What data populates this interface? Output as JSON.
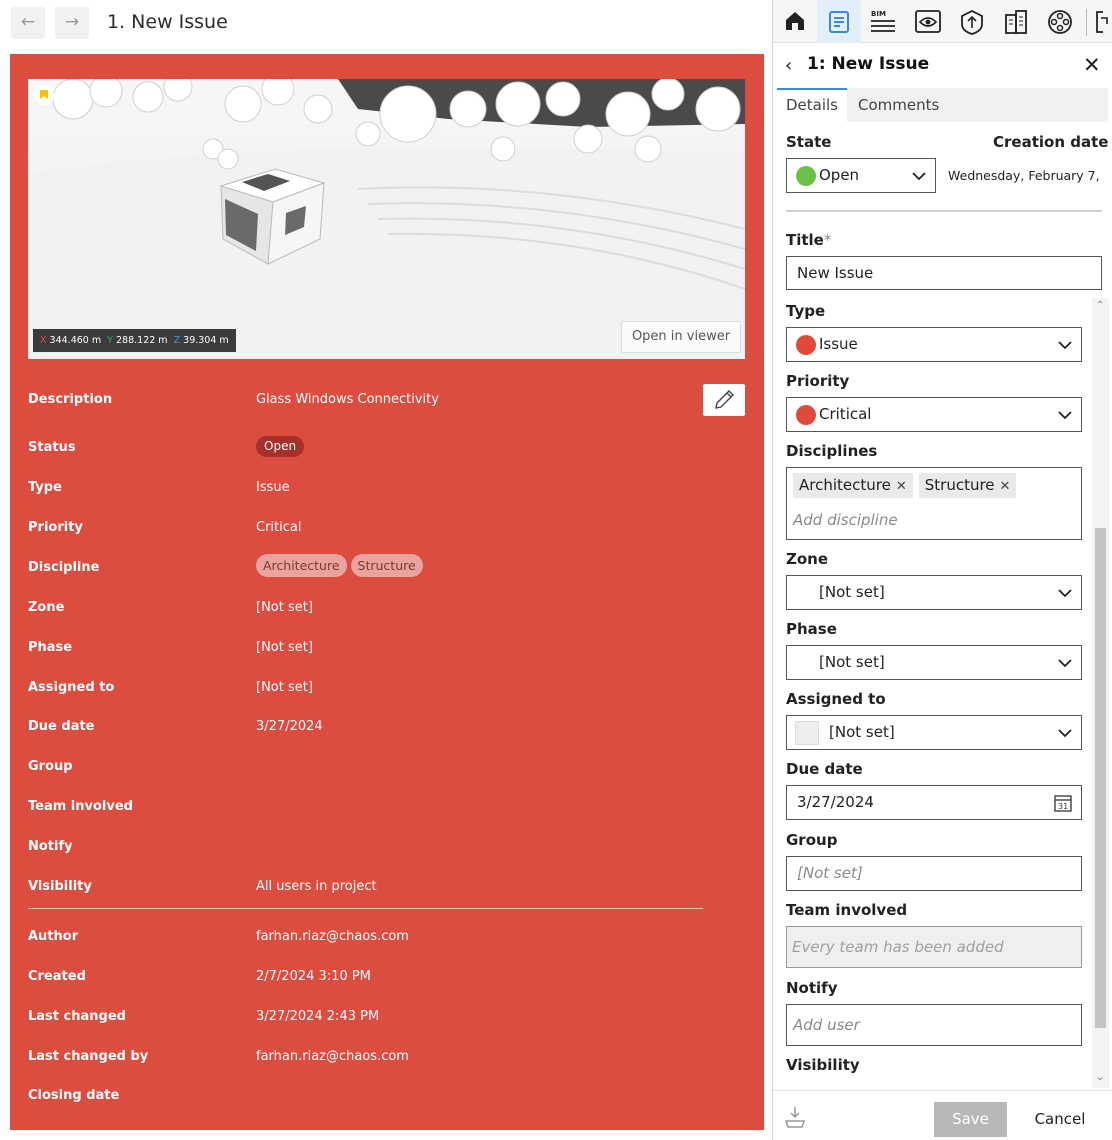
{
  "left": {
    "title": "1. New Issue",
    "viewer": {
      "coords": {
        "x_prefix": "X",
        "x": "344.460 m",
        "y_prefix": "Y",
        "y": "288.122 m",
        "z_prefix": "Z",
        "z": "39.304 m"
      },
      "open_in_viewer": "Open in viewer"
    },
    "props": {
      "description": {
        "label": "Description",
        "value": "Glass Windows Connectivity"
      },
      "status": {
        "label": "Status",
        "value": "Open"
      },
      "type": {
        "label": "Type",
        "value": "Issue"
      },
      "priority": {
        "label": "Priority",
        "value": "Critical"
      },
      "discipline": {
        "label": "Discipline",
        "values": [
          "Architecture",
          "Structure"
        ]
      },
      "zone": {
        "label": "Zone",
        "value": "[Not set]"
      },
      "phase": {
        "label": "Phase",
        "value": "[Not set]"
      },
      "assigned_to": {
        "label": "Assigned to",
        "value": "[Not set]"
      },
      "due_date": {
        "label": "Due date",
        "value": "3/27/2024"
      },
      "group": {
        "label": "Group",
        "value": ""
      },
      "team_involved": {
        "label": "Team involved",
        "value": ""
      },
      "notify": {
        "label": "Notify",
        "value": ""
      },
      "visibility": {
        "label": "Visibility",
        "value": "All users in project"
      },
      "author": {
        "label": "Author",
        "value": "farhan.riaz@chaos.com"
      },
      "created": {
        "label": "Created",
        "value": "2/7/2024 3:10 PM"
      },
      "last_changed": {
        "label": "Last changed",
        "value": "3/27/2024 2:43 PM"
      },
      "last_changed_by": {
        "label": "Last changed by",
        "value": "farhan.riaz@chaos.com"
      },
      "closing_date": {
        "label": "Closing date",
        "value": ""
      }
    }
  },
  "right": {
    "toolbar": {
      "bim_label": "BIM"
    },
    "header": {
      "title": "1: New Issue"
    },
    "tabs": {
      "details": "Details",
      "comments": "Comments"
    },
    "state": {
      "label": "State",
      "value": "Open",
      "color": "#6cc04a"
    },
    "creation_date": {
      "label": "Creation date",
      "value": "Wednesday, February 7, ..."
    },
    "title": {
      "label": "Title",
      "required_mark": "*",
      "value": "New Issue"
    },
    "type": {
      "label": "Type",
      "value": "Issue",
      "color": "#e04a3b"
    },
    "priority": {
      "label": "Priority",
      "value": "Critical",
      "color": "#e04a3b"
    },
    "disciplines": {
      "label": "Disciplines",
      "tags": [
        "Architecture",
        "Structure"
      ],
      "placeholder": "Add discipline"
    },
    "zone": {
      "label": "Zone",
      "value": "[Not set]"
    },
    "phase": {
      "label": "Phase",
      "value": "[Not set]"
    },
    "assigned_to": {
      "label": "Assigned to",
      "value": "[Not set]"
    },
    "due_date": {
      "label": "Due date",
      "value": "3/27/2024",
      "calendar_day": "31"
    },
    "group": {
      "label": "Group",
      "placeholder": "[Not set]"
    },
    "team_involved": {
      "label": "Team involved",
      "placeholder": "Every team has been added"
    },
    "notify": {
      "label": "Notify",
      "placeholder": "Add user"
    },
    "visibility": {
      "label": "Visibility"
    },
    "footer": {
      "save": "Save",
      "cancel": "Cancel"
    }
  },
  "colors": {
    "card": "#dc4c3f",
    "accent": "#3a8ad8",
    "status_open_pill": "#a6302a"
  }
}
